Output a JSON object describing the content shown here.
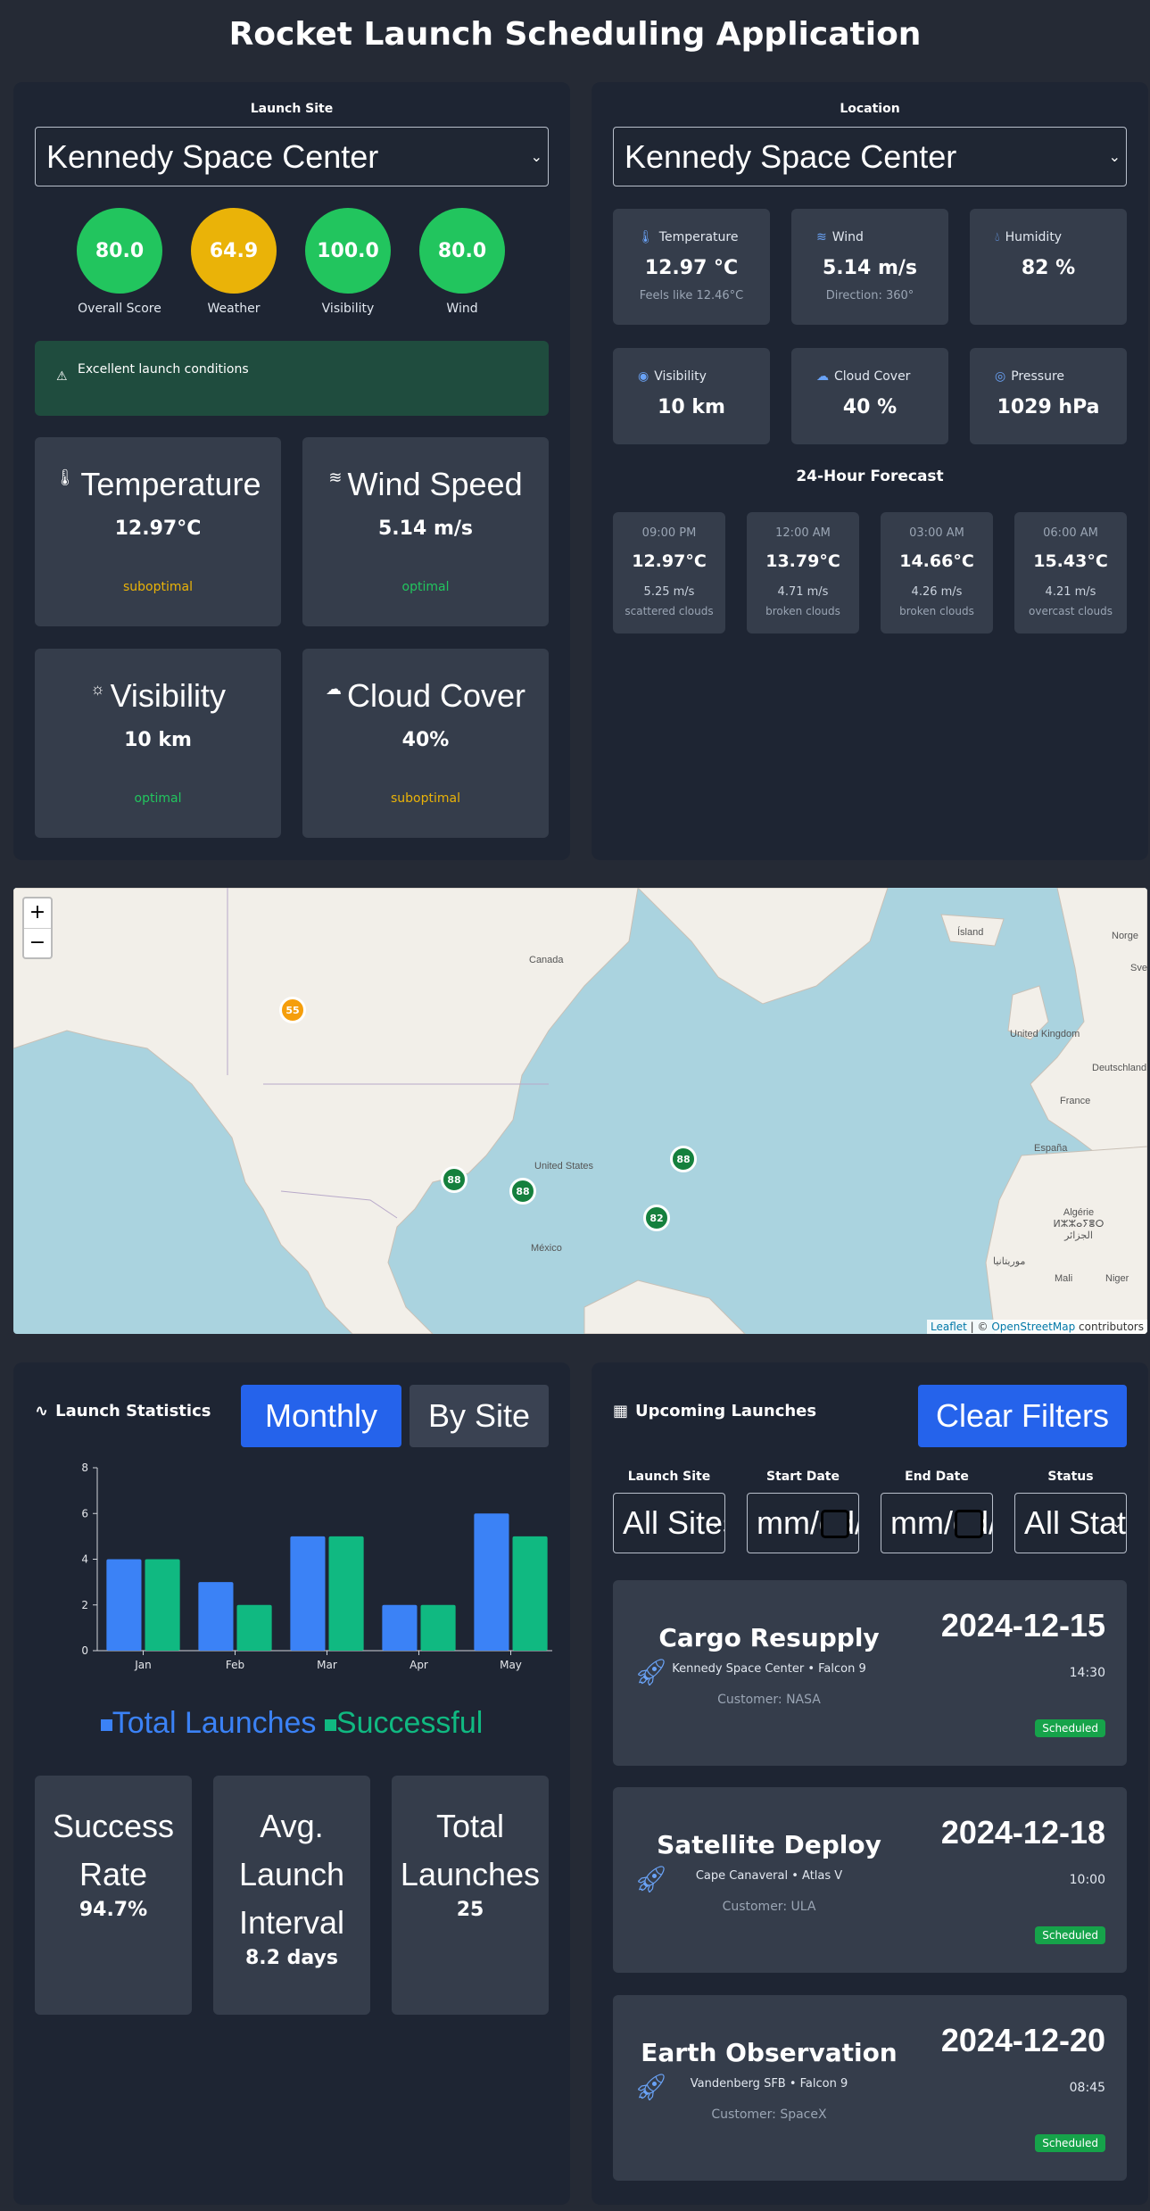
{
  "app": {
    "title": "Rocket Launch Scheduling Application"
  },
  "colors": {
    "green": "#22c55e",
    "amber": "#eab308",
    "blue": "#3b82f6",
    "teal": "#10b981"
  },
  "scores_panel": {
    "site_label": "Launch Site",
    "site_value": "Kennedy Space Center",
    "scores": [
      {
        "value": "80.0",
        "label": "Overall Score",
        "color": "#22c55e"
      },
      {
        "value": "64.9",
        "label": "Weather",
        "color": "#eab308"
      },
      {
        "value": "100.0",
        "label": "Visibility",
        "color": "#22c55e"
      },
      {
        "value": "80.0",
        "label": "Wind",
        "color": "#22c55e"
      }
    ],
    "alert": "Excellent launch conditions",
    "conditions": [
      {
        "icon": "thermometer-icon",
        "title": "Temperature",
        "value": "12.97°C",
        "status": "suboptimal"
      },
      {
        "icon": "wind-icon",
        "title": "Wind Speed",
        "value": "5.14 m/s",
        "status": "optimal"
      },
      {
        "icon": "sun-icon",
        "title": "Visibility",
        "value": "10 km",
        "status": "optimal"
      },
      {
        "icon": "cloud-icon",
        "title": "Cloud Cover",
        "value": "40%",
        "status": "suboptimal"
      }
    ]
  },
  "weather_panel": {
    "location_label": "Location",
    "location_value": "Kennedy Space Center",
    "tiles": [
      {
        "icon": "thermometer-icon",
        "title": "Temperature",
        "value": "12.97 °C",
        "sub": "Feels like 12.46°C"
      },
      {
        "icon": "wind-icon",
        "title": "Wind",
        "value": "5.14 m/s",
        "sub": "Direction: 360°"
      },
      {
        "icon": "droplet-icon",
        "title": "Humidity",
        "value": "82 %",
        "sub": ""
      },
      {
        "icon": "eye-icon",
        "title": "Visibility",
        "value": "10 km",
        "sub": ""
      },
      {
        "icon": "cloud-icon",
        "title": "Cloud Cover",
        "value": "40 %",
        "sub": ""
      },
      {
        "icon": "compass-icon",
        "title": "Pressure",
        "value": "1029 hPa",
        "sub": ""
      }
    ],
    "forecast_title": "24-Hour Forecast",
    "forecast": [
      {
        "time": "09:00 PM",
        "temp": "12.97°C",
        "wind": "5.25 m/s",
        "desc": "scattered clouds"
      },
      {
        "time": "12:00 AM",
        "temp": "13.79°C",
        "wind": "4.71 m/s",
        "desc": "broken clouds"
      },
      {
        "time": "03:00 AM",
        "temp": "14.66°C",
        "wind": "4.26 m/s",
        "desc": "broken clouds"
      },
      {
        "time": "06:00 AM",
        "temp": "15.43°C",
        "wind": "4.21 m/s",
        "desc": "overcast clouds"
      }
    ]
  },
  "map": {
    "zoom_in": "+",
    "zoom_out": "−",
    "labels": [
      "Canada",
      "United States",
      "México",
      "Ísland",
      "United Kingdom",
      "Norge",
      "France",
      "España",
      "Deutschland",
      "Algérie ⵍⵣⵣⴰⵢⴻⵔ الجزائر",
      "Mali",
      "Niger",
      "موريتانيا",
      "Sve"
    ],
    "markers": [
      {
        "value": "55",
        "color": "#f59e0b"
      },
      {
        "value": "88",
        "color": "#15803d"
      },
      {
        "value": "88",
        "color": "#15803d"
      },
      {
        "value": "88",
        "color": "#15803d"
      },
      {
        "value": "82",
        "color": "#15803d"
      }
    ],
    "attribution": {
      "leaflet": "Leaflet",
      "sep": " | © ",
      "osm": "OpenStreetMap",
      "tail": " contributors"
    }
  },
  "stats": {
    "title": "Launch Statistics",
    "tabs": [
      "Monthly",
      "By Site"
    ],
    "cards": [
      {
        "label": "Success Rate",
        "value": "94.7%"
      },
      {
        "label": "Avg. Launch Interval",
        "value": "8.2 days"
      },
      {
        "label": "Total Launches",
        "value": "25"
      }
    ]
  },
  "chart_data": {
    "type": "bar",
    "categories": [
      "Jan",
      "Feb",
      "Mar",
      "Apr",
      "May"
    ],
    "series": [
      {
        "name": "Total Launches",
        "values": [
          4,
          3,
          5,
          2,
          6
        ],
        "color": "#3b82f6"
      },
      {
        "name": "Successful",
        "values": [
          4,
          2,
          5,
          2,
          5
        ],
        "color": "#10b981"
      }
    ],
    "yticks": [
      0,
      2,
      4,
      6,
      8
    ],
    "ylim": [
      0,
      8
    ],
    "legend": "bottom"
  },
  "upcoming": {
    "title": "Upcoming Launches",
    "clear_label": "Clear Filters",
    "filters": [
      {
        "label": "Launch Site",
        "value": "All Sites",
        "kind": "select"
      },
      {
        "label": "Start Date",
        "value": "mm/dd/yyyy",
        "kind": "date"
      },
      {
        "label": "End Date",
        "value": "mm/dd/yyyy",
        "kind": "date"
      },
      {
        "label": "Status",
        "value": "All Status",
        "kind": "select"
      }
    ],
    "launches": [
      {
        "name": "Cargo Resupply",
        "detail": "Kennedy Space Center • Falcon 9",
        "customer": "Customer: NASA",
        "date": "2024-12-15",
        "time": "14:30",
        "status": "Scheduled"
      },
      {
        "name": "Satellite Deploy",
        "detail": "Cape Canaveral • Atlas V",
        "customer": "Customer: ULA",
        "date": "2024-12-18",
        "time": "10:00",
        "status": "Scheduled"
      },
      {
        "name": "Earth Observation",
        "detail": "Vandenberg SFB • Falcon 9",
        "customer": "Customer: SpaceX",
        "date": "2024-12-20",
        "time": "08:45",
        "status": "Scheduled"
      }
    ]
  }
}
